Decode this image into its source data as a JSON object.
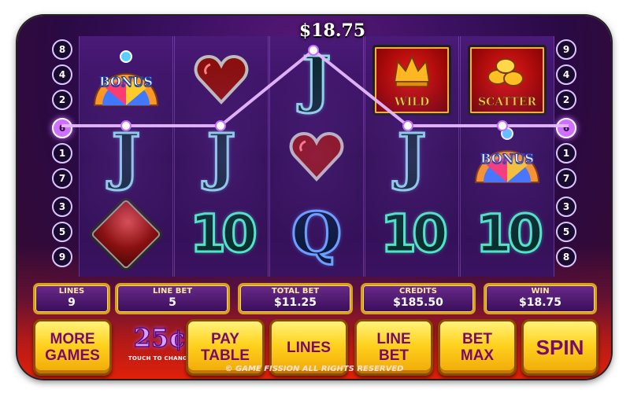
{
  "win_banner": "$18.75",
  "line_numbers": {
    "left": [
      "8",
      "4",
      "2",
      "6",
      "1",
      "7",
      "3",
      "5",
      "9"
    ],
    "right": [
      "9",
      "4",
      "2",
      "6",
      "1",
      "7",
      "3",
      "5",
      "8"
    ],
    "active": "6"
  },
  "reels": [
    [
      "bonus",
      "j",
      "diamond"
    ],
    [
      "heart",
      "j",
      "10"
    ],
    [
      "j",
      "heart",
      "q"
    ],
    [
      "wild",
      "j",
      "10"
    ],
    [
      "scatter",
      "bonus",
      "10"
    ]
  ],
  "symbols": {
    "j": "J",
    "q": "Q",
    "ten": "10",
    "bonus": "BONUS",
    "wild": "WILD",
    "scatter": "SCATTER"
  },
  "info": {
    "lines": {
      "label": "LINES",
      "value": "9"
    },
    "line_bet": {
      "label": "LINE BET",
      "value": "5"
    },
    "total_bet": {
      "label": "TOTAL BET",
      "value": "$11.25"
    },
    "credits": {
      "label": "CREDITS",
      "value": "$185.50"
    },
    "win": {
      "label": "WIN",
      "value": "$18.75"
    }
  },
  "buttons": {
    "more_games": "MORE\nGAMES",
    "coin_value": "25¢",
    "coin_hint": "TOUCH TO CHANGE",
    "pay_table": "PAY\nTABLE",
    "lines": "LINES",
    "line_bet": "LINE\nBET",
    "bet_max": "BET\nMAX",
    "spin": "SPIN"
  },
  "copyright": "© GAME FISSION ALL RIGHTS RESERVED",
  "colors": {
    "button_text": "#7a0a6a",
    "button_fill": "#ffd21e",
    "payline": "#e8b8ff",
    "frame_border": "#d8a020"
  }
}
